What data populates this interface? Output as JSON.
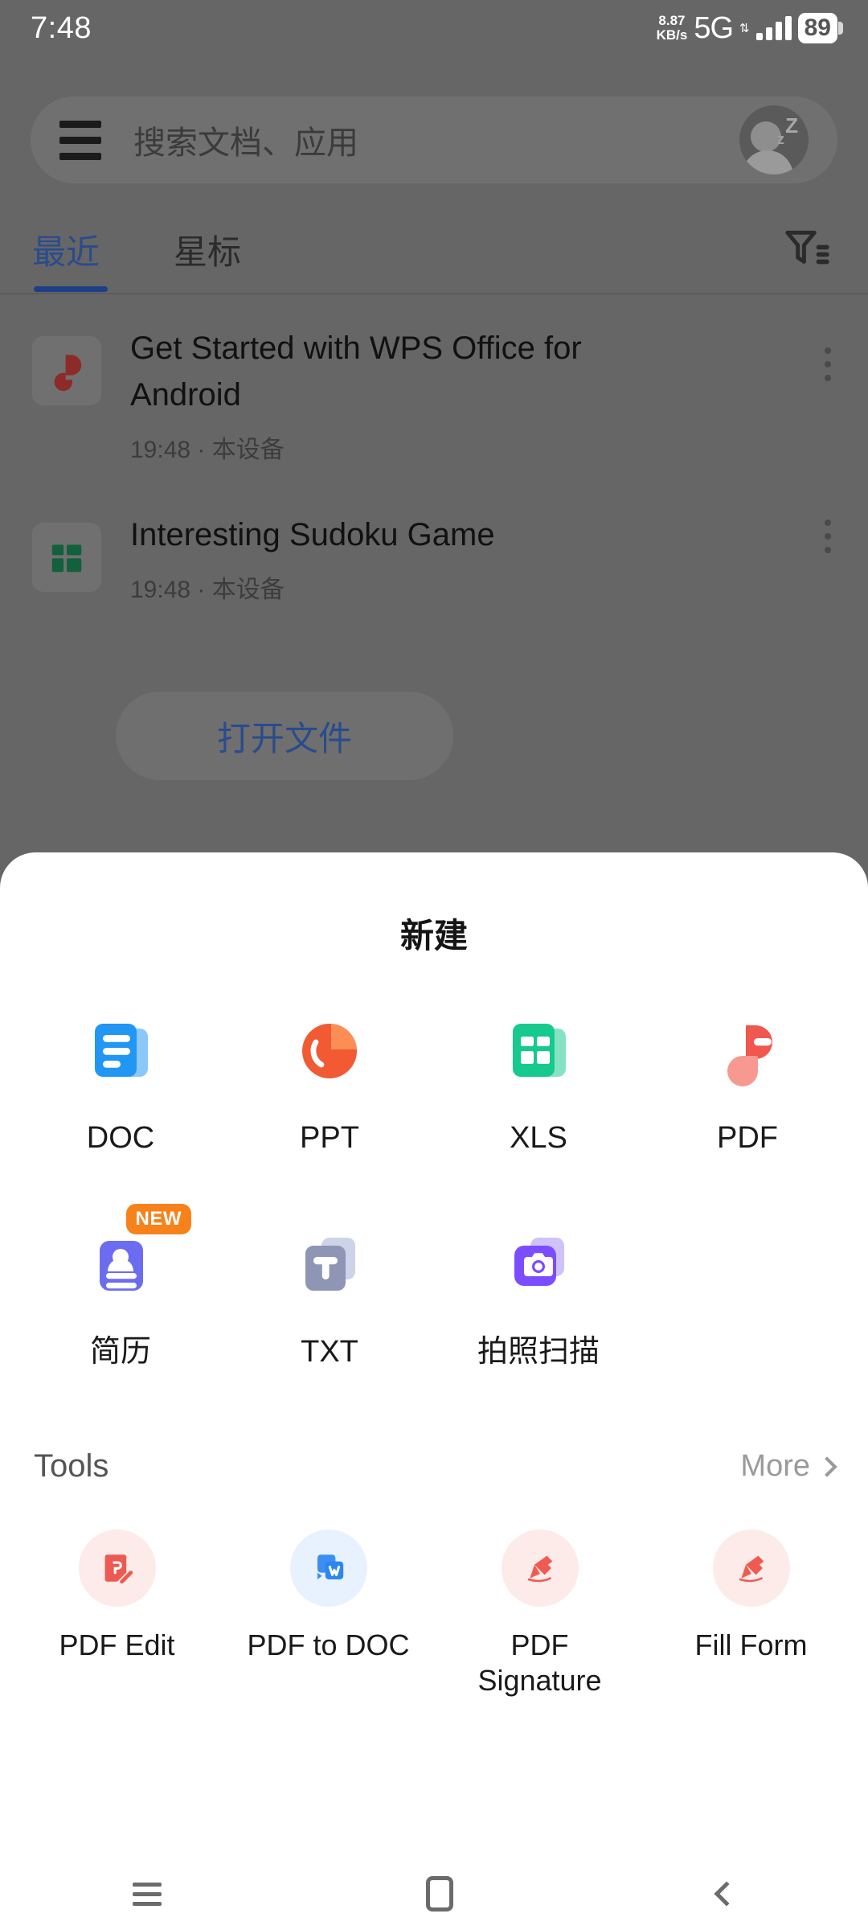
{
  "status_bar": {
    "time": "7:48",
    "net_speed_value": "8.87",
    "net_speed_unit": "KB/s",
    "network": "5G",
    "battery": "89"
  },
  "search": {
    "placeholder": "搜索文档、应用",
    "menu_icon": "hamburger-menu-icon",
    "avatar_icon": "avatar-sleep-icon"
  },
  "tabs": {
    "recent": "最近",
    "starred": "星标",
    "filter_icon": "filter-icon"
  },
  "files": [
    {
      "name": "Get Started with WPS Office for Android",
      "meta": "19:48 · 本设备",
      "icon": "pdf-file-icon"
    },
    {
      "name": "Interesting Sudoku Game",
      "meta": "19:48 · 本设备",
      "icon": "xls-file-icon"
    }
  ],
  "open_file_button": "打开文件",
  "sheet": {
    "title": "新建",
    "new_items": [
      {
        "label": "DOC",
        "icon": "doc-icon",
        "badge": ""
      },
      {
        "label": "PPT",
        "icon": "ppt-icon",
        "badge": ""
      },
      {
        "label": "XLS",
        "icon": "xls-icon",
        "badge": ""
      },
      {
        "label": "PDF",
        "icon": "pdf-icon",
        "badge": ""
      },
      {
        "label": "简历",
        "icon": "resume-icon",
        "badge": "NEW"
      },
      {
        "label": "TXT",
        "icon": "txt-icon",
        "badge": ""
      },
      {
        "label": "拍照扫描",
        "icon": "camera-scan-icon",
        "badge": ""
      }
    ],
    "tools": {
      "title": "Tools",
      "more": "More",
      "items": [
        {
          "label": "PDF Edit",
          "icon": "pdf-edit-icon"
        },
        {
          "label": "PDF to DOC",
          "icon": "pdf-to-doc-icon"
        },
        {
          "label": "PDF Signature",
          "icon": "pdf-signature-icon"
        },
        {
          "label": "Fill Form",
          "icon": "fill-form-icon"
        }
      ]
    }
  },
  "nav_bar": {
    "recents": "recents-icon",
    "home": "home-icon",
    "back": "back-icon"
  },
  "colors": {
    "accent_blue": "#2a4b8d",
    "doc_blue": "#2196f3",
    "ppt_orange": "#f15a33",
    "xls_green": "#16c98d",
    "pdf_red": "#f0574f",
    "resume_purple": "#6c6cf0",
    "txt_gray": "#8f96b5",
    "scan_purple": "#7c4dff",
    "badge_orange": "#f7821b",
    "scrim": "#666666"
  }
}
